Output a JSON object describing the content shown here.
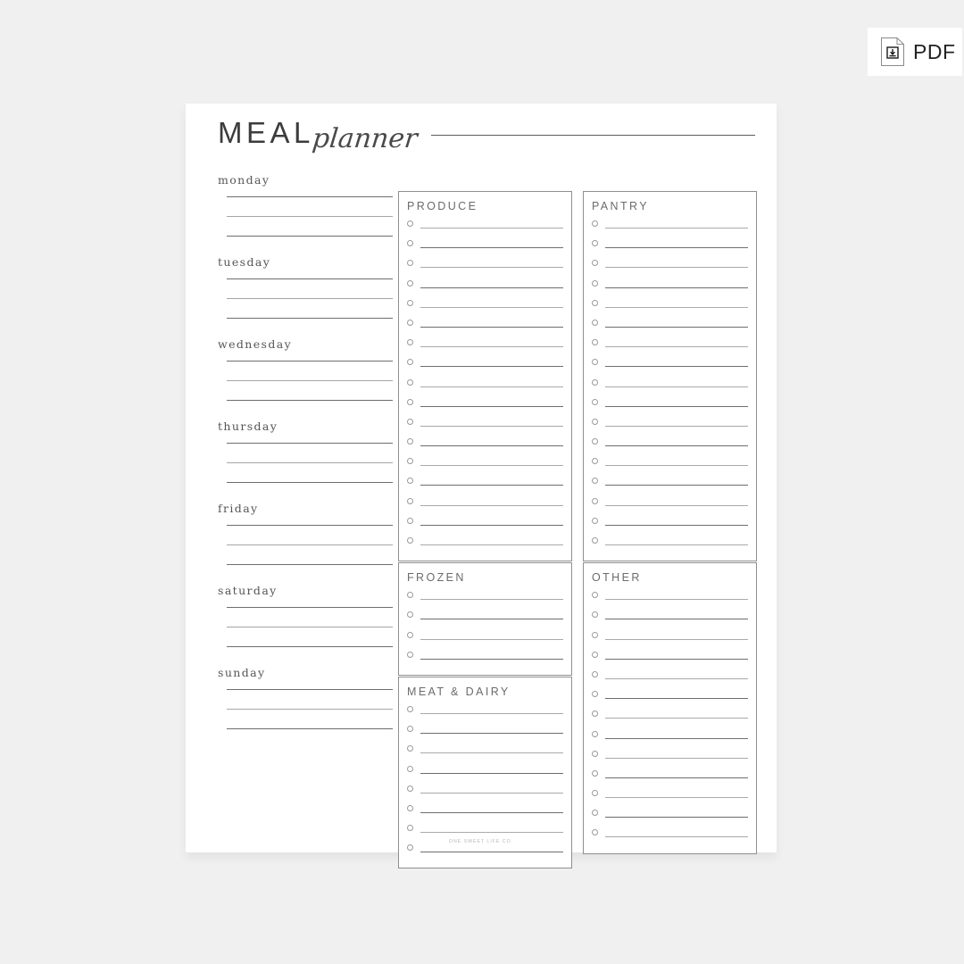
{
  "pdf_badge": {
    "label": "PDF",
    "icon": "document-download-icon"
  },
  "page": {
    "title_primary": "MEAL",
    "title_script": "planner",
    "footer": "ONE SWEET LIFE CO."
  },
  "days": [
    {
      "label": "monday",
      "lines": 3
    },
    {
      "label": "tuesday",
      "lines": 3
    },
    {
      "label": "wednesday",
      "lines": 3
    },
    {
      "label": "thursday",
      "lines": 3
    },
    {
      "label": "friday",
      "lines": 3
    },
    {
      "label": "saturday",
      "lines": 3
    },
    {
      "label": "sunday",
      "lines": 3
    }
  ],
  "grocery": {
    "left_column": [
      {
        "title": "PRODUCE",
        "rows": 17
      },
      {
        "title": "FROZEN",
        "rows": 4
      },
      {
        "title": "MEAT & DAIRY",
        "rows": 8
      }
    ],
    "right_column": [
      {
        "title": "PANTRY",
        "rows": 17
      },
      {
        "title": "OTHER",
        "rows": 13
      }
    ]
  },
  "colors": {
    "canvas": "#f0f0f0",
    "sheet": "#ffffff",
    "rule_dark": "#6e6e6e",
    "rule_light": "#a9a9a9",
    "box_border": "#8f8f8f",
    "heading": "#6b6b6b",
    "day_label": "#555555",
    "title": "#3c3c3c",
    "footer": "#b9b9b9"
  }
}
